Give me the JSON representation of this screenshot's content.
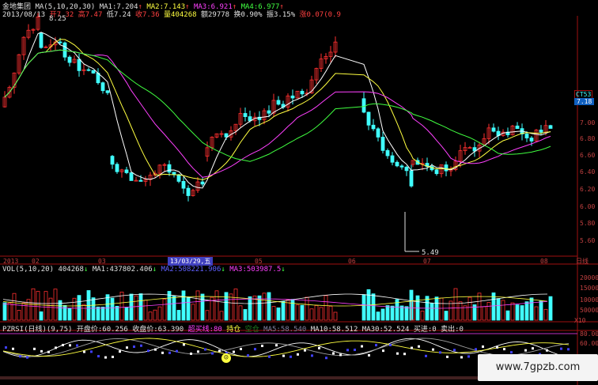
{
  "header": {
    "stock_name": "金地集团",
    "ma_params": "MA(5,10,20,30)",
    "ma1": "MA1:7.204",
    "ma2": "MA2:7.143",
    "ma3": "MA3:6.921",
    "ma4": "MA4:6.977"
  },
  "quote": {
    "date": "2013/08/13",
    "open": "开7.32",
    "high": "高7.47",
    "low": "低7.24",
    "close": "收7.36",
    "volume": "量404268",
    "amount": "额29778",
    "turnover": "换0.90%",
    "amplitude": "振3.15%",
    "change": "涨0.07(0.9"
  },
  "markers": {
    "high_marker": "8.25",
    "low_marker": "5.49",
    "stock_code": "CT53",
    "price_tag": "7.18"
  },
  "y_axis": [
    "7.00",
    "6.80",
    "6.60",
    "6.40",
    "6.20",
    "6.00",
    "5.80",
    "5.60"
  ],
  "x_axis": {
    "year": "2013",
    "months": [
      "02",
      "03",
      "05",
      "06",
      "07",
      "08"
    ],
    "cursor_date": "13/03/29,五",
    "period": "日线"
  },
  "volume_panel": {
    "title": "VOL(5,10,20)",
    "value": "404268",
    "ma1": "MA1:437802.406",
    "ma2": "MA2:508221.906",
    "ma3": "MA3:503987.5",
    "axis": [
      "200000",
      "150000",
      "100000",
      "50000"
    ],
    "unit": "X10"
  },
  "indicator_panel": {
    "title": "PZRSI(日线)(9,75)",
    "open_price": "开盘价:60.256",
    "close_price": "收盘价:63.390",
    "overbought": "超买线:80",
    "hold": "持仓",
    "short": "空仓",
    "ma5": "MA5:58.540",
    "ma10": "MA10:58.512",
    "ma30": "MA30:52.524",
    "buy": "买进:0",
    "sell": "卖出:0",
    "axis": [
      "80.00",
      "60.00"
    ]
  },
  "watermark": "www.7gpzb.com",
  "colors": {
    "up": "#ff3030",
    "down": "#40ffff",
    "ma5": "#ffffff",
    "ma10": "#ffff40",
    "ma20": "#ff40ff",
    "ma30": "#40ff40",
    "border": "#a01010"
  }
}
